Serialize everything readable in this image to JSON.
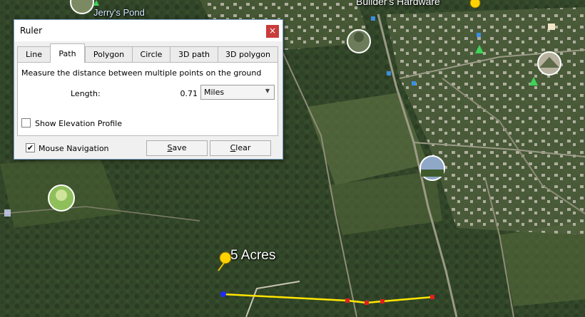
{
  "map": {
    "labels": {
      "jerrys_pond": "Jerry's Pond",
      "builders_hardware": "Builder's Hardware",
      "acres": "5 Acres"
    },
    "colors": {
      "path_line": "#ffe600",
      "start_point": "#1a2cff",
      "vertex": "#e02020",
      "close_button": "#c83c3c"
    }
  },
  "ruler": {
    "title": "Ruler",
    "close_symbol": "×",
    "tabs": [
      "Line",
      "Path",
      "Polygon",
      "Circle",
      "3D path",
      "3D polygon"
    ],
    "active_tab": "Path",
    "description": "Measure the distance between multiple points on the ground",
    "length_label": "Length:",
    "length_value": "0.71",
    "unit_selected": "Miles",
    "dropdown_arrow": "▼",
    "elevation_label": "Show Elevation Profile",
    "elevation_checked": false,
    "mouse_nav_label": "Mouse Navigation",
    "mouse_nav_checked": true,
    "checkmark": "✔",
    "save_label_hot": "S",
    "save_label_rest": "ave",
    "clear_label_hot": "C",
    "clear_label_rest": "lear"
  }
}
